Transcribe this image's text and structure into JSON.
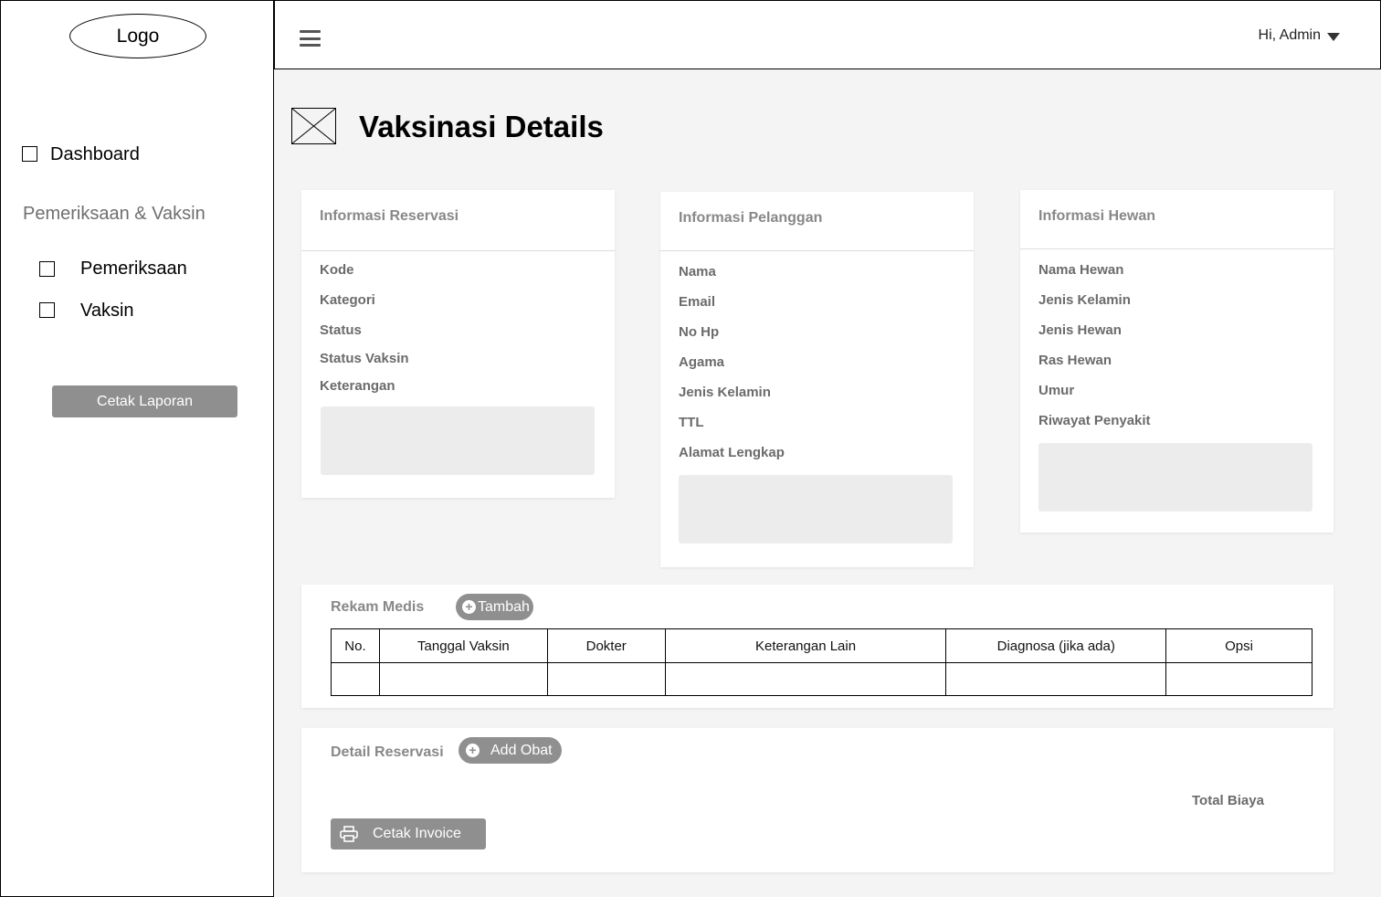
{
  "sidebar": {
    "logo": "Logo",
    "dashboard_label": "Dashboard",
    "section_label": "Pemeriksaan & Vaksin",
    "items": [
      {
        "label": "Pemeriksaan"
      },
      {
        "label": "Vaksin"
      }
    ],
    "cetak_laporan_label": "Cetak Laporan"
  },
  "header": {
    "user_greeting": "Hi, Admin"
  },
  "page": {
    "title": "Vaksinasi Details"
  },
  "cards": {
    "reservasi": {
      "title": "Informasi Reservasi",
      "fields": [
        "Kode",
        "Kategori",
        "Status",
        "Status Vaksin",
        "Keterangan"
      ]
    },
    "pelanggan": {
      "title": "Informasi Pelanggan",
      "fields": [
        "Nama",
        "Email",
        "No Hp",
        "Agama",
        "Jenis Kelamin",
        "TTL",
        "Alamat Lengkap"
      ]
    },
    "hewan": {
      "title": "Informasi Hewan",
      "fields": [
        "Nama Hewan",
        "Jenis Kelamin",
        "Jenis Hewan",
        "Ras Hewan",
        "Umur",
        "Riwayat Penyakit"
      ]
    }
  },
  "rekam_medis": {
    "title": "Rekam Medis",
    "add_label": "Tambah",
    "columns": [
      "No.",
      "Tanggal Vaksin",
      "Dokter",
      "Keterangan Lain",
      "Diagnosa (jika ada)",
      "Opsi"
    ]
  },
  "detail_reservasi": {
    "title": "Detail Reservasi",
    "add_obat_label": "Add Obat",
    "total_label": "Total Biaya",
    "cetak_invoice_label": "Cetak Invoice"
  },
  "colors": {
    "button_gray": "#8f8f8f",
    "background": "#f4f4f4"
  },
  "icons": [
    "checkbox-icon",
    "hamburger-menu-icon",
    "caret-down-icon",
    "image-placeholder-icon",
    "plus-circle-icon",
    "printer-icon"
  ]
}
